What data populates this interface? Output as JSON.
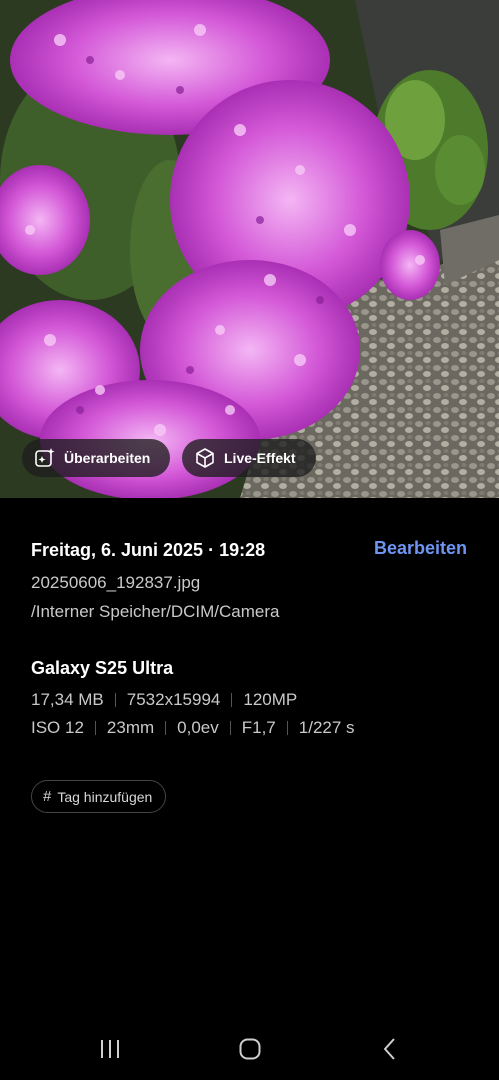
{
  "photo": {
    "description_icon": "photo-preview",
    "chips": {
      "edit_label": "Überarbeiten",
      "edit_icon": "sparkle-edit-icon",
      "live_label": "Live-Effekt",
      "live_icon": "cube-effect-icon"
    }
  },
  "details": {
    "date": "Freitag, 6. Juni 2025 · 19:28",
    "edit_link": "Bearbeiten",
    "filename": "20250606_192837.jpg",
    "path": "/Interner Speicher/DCIM/Camera",
    "model": "Galaxy S25 Ultra",
    "specs_row1": [
      "17,34 MB",
      "7532x15994",
      "120MP"
    ],
    "specs_row2": [
      "ISO 12",
      "23mm",
      "0,0ev",
      "F1,7",
      "1/227 s"
    ],
    "tag_button": "Tag hinzufügen"
  },
  "navbar": {
    "recents_icon": "recents-icon",
    "home_icon": "home-icon",
    "back_icon": "back-icon"
  },
  "colors": {
    "background": "#000000",
    "accent_link": "#6e95f2",
    "secondary_text": "#c9c9c9"
  }
}
